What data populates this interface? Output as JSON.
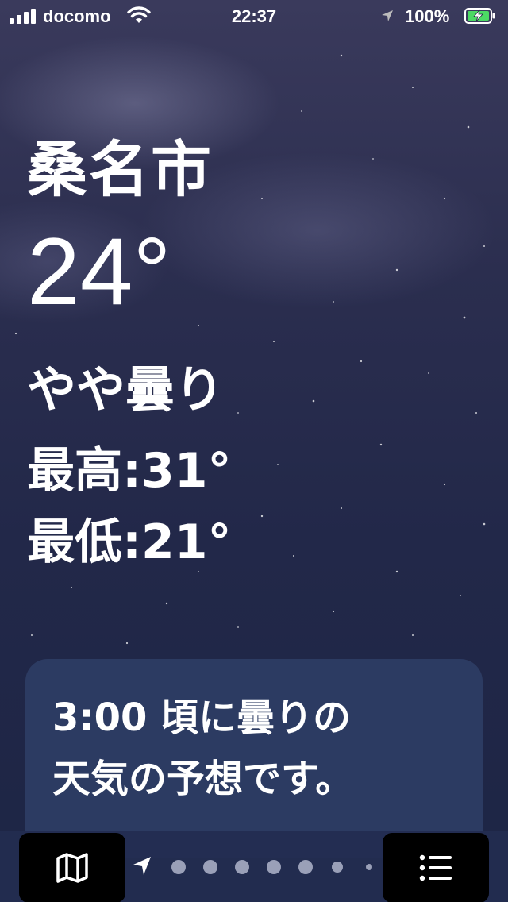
{
  "status_bar": {
    "carrier": "docomo",
    "time": "22:37",
    "battery_percent": "100%",
    "battery_charging": true
  },
  "weather": {
    "city": "桑名市",
    "temperature": "24°",
    "condition": "やや曇り",
    "high": "最高:31°",
    "low": "最低:21°"
  },
  "forecast_card": {
    "line1": "3:00 頃に曇りの",
    "line2": "天気の予想です。"
  },
  "toolbar": {
    "map_icon": "map-icon",
    "list_icon": "list-icon",
    "location_page_icon": "location-arrow-icon",
    "page_count": 7,
    "current_page": 1
  },
  "colors": {
    "background_top": "#3a3a5c",
    "background_bottom": "#1d2545",
    "card": "#2c3b62",
    "battery_green": "#4cd964"
  }
}
